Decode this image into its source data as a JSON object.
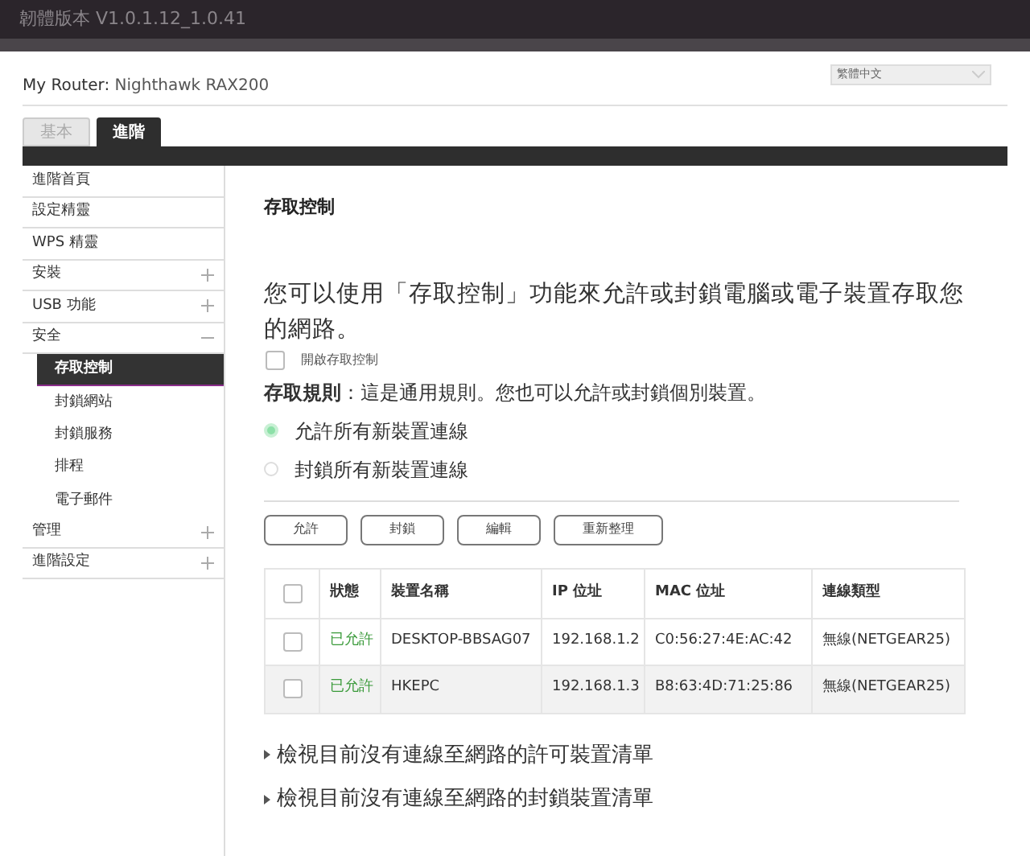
{
  "top_bar": {
    "firmware": "韌體版本 V1.0.1.12_1.0.41"
  },
  "header": {
    "router_label": "My Router:",
    "router_name": "Nighthawk RAX200",
    "language": "繁體中文"
  },
  "tabs": [
    {
      "label": "基本",
      "selected": false
    },
    {
      "label": "進階",
      "selected": true
    }
  ],
  "sidebar": {
    "items": [
      {
        "label": "進階首頁",
        "kind": "link"
      },
      {
        "label": "設定精靈",
        "kind": "link"
      },
      {
        "label": "WPS 精靈",
        "kind": "link"
      },
      {
        "label": "安裝",
        "kind": "group",
        "expanded": false
      },
      {
        "label": "USB 功能",
        "kind": "group",
        "expanded": false
      },
      {
        "label": "安全",
        "kind": "group",
        "expanded": true,
        "children": [
          {
            "label": "存取控制",
            "selected": true
          },
          {
            "label": "封鎖網站",
            "selected": false
          },
          {
            "label": "封鎖服務",
            "selected": false
          },
          {
            "label": "排程",
            "selected": false
          },
          {
            "label": "電子郵件",
            "selected": false
          }
        ]
      },
      {
        "label": "管理",
        "kind": "group",
        "expanded": false
      },
      {
        "label": "進階設定",
        "kind": "group",
        "expanded": false
      }
    ]
  },
  "content": {
    "title": "存取控制",
    "description": "您可以使用「存取控制」功能來允許或封鎖電腦或電子裝置存取您的網路。",
    "enable_checkbox": {
      "label": "開啟存取控制",
      "checked": false
    },
    "rule": "**存取規則**：這是通用規則。您也可以允許或封鎖個別裝置。",
    "radios": [
      {
        "label": "允許所有新裝置連線",
        "selected": true
      },
      {
        "label": "封鎖所有新裝置連線",
        "selected": false
      }
    ],
    "buttons": [
      "允許",
      "封鎖",
      "編輯",
      "重新整理"
    ],
    "table": {
      "select_all_checked": false,
      "columns": [
        "狀態",
        "裝置名稱",
        "IP 位址",
        "MAC 位址",
        "連線類型"
      ],
      "rows": [
        {
          "checked": false,
          "status": "已允許",
          "name": "DESKTOP-BBSAG07",
          "ip": "192.168.1.2",
          "mac": "C0:56:27:4E:AC:42",
          "type": "無線(NETGEAR25)"
        },
        {
          "checked": false,
          "status": "已允許",
          "name": "HKEPC",
          "ip": "192.168.1.3",
          "mac": "B8:63:4D:71:25:86",
          "type": "無線(NETGEAR25)"
        }
      ]
    },
    "links": [
      "檢視目前沒有連線至網路的許可裝置清單",
      "檢視目前沒有連線至網路的封鎖裝置清單"
    ]
  }
}
